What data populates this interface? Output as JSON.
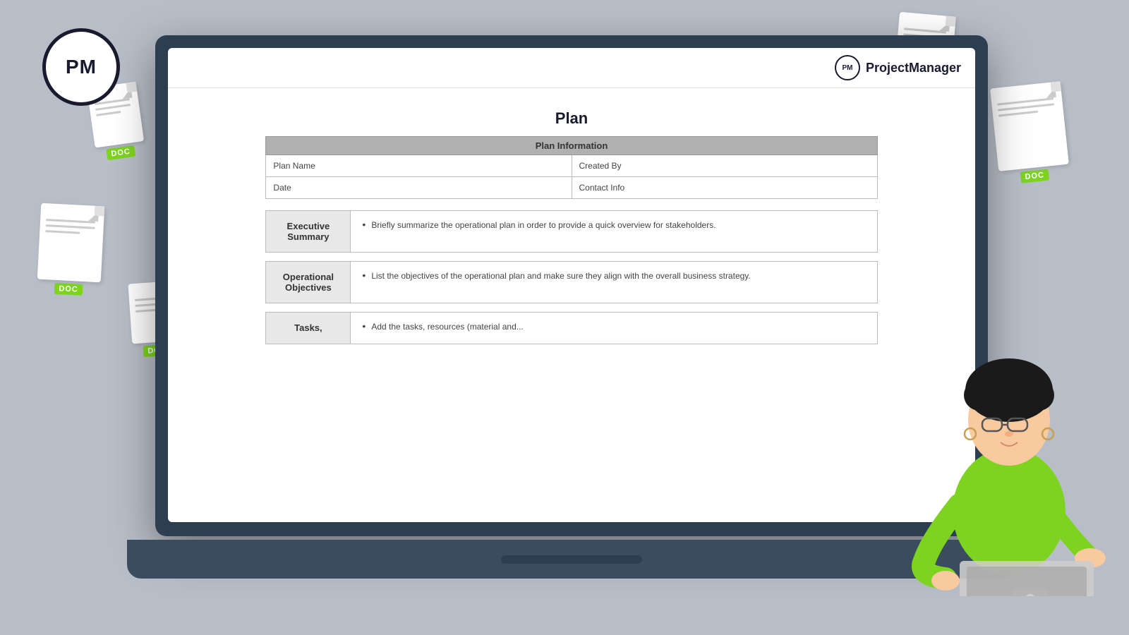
{
  "logo": {
    "text": "PM"
  },
  "docBadge": "DOC",
  "laptop": {
    "header": {
      "pm_circle": "PM",
      "pm_name": "ProjectManager"
    },
    "document": {
      "title": "Plan",
      "table": {
        "header": "Plan Information",
        "rows": [
          {
            "col1": "Plan Name",
            "col2": "Created By"
          },
          {
            "col1": "Date",
            "col2": "Contact Info"
          }
        ]
      },
      "sections": [
        {
          "label": "Executive\nSummary",
          "content": "Briefly summarize the operational plan in order to provide a quick overview for stakeholders."
        },
        {
          "label": "Operational\nObjectives",
          "content": "List the objectives of the operational plan and make sure they align with the overall business strategy."
        },
        {
          "label": "Tasks,",
          "content": "Add the tasks, resources (material and..."
        }
      ]
    }
  }
}
